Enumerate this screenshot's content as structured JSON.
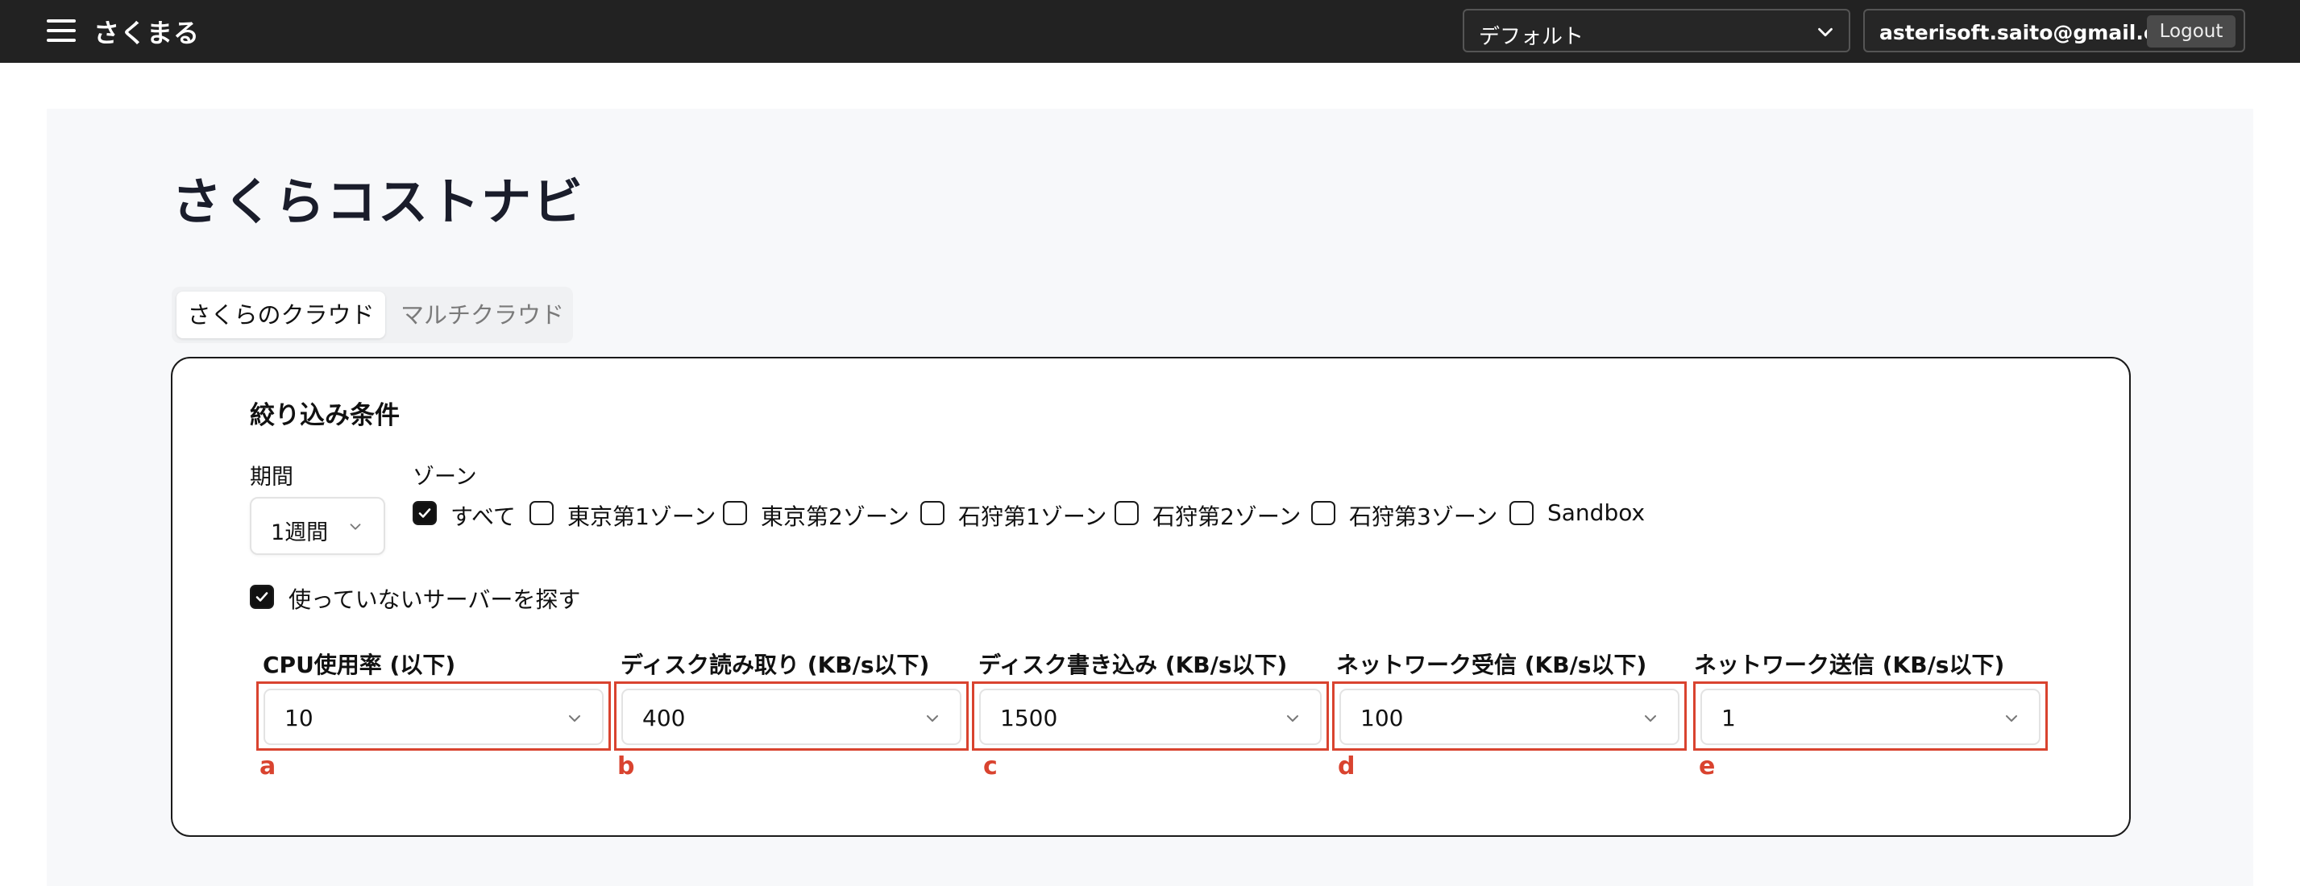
{
  "header": {
    "brand": "さくまる",
    "profile_select": {
      "value": "デフォルト"
    },
    "account": {
      "email": "asterisoft.saito@gmail.com",
      "logout_label": "Logout"
    }
  },
  "main": {
    "title": "さくらコストナビ",
    "tabs": [
      {
        "label": "さくらのクラウド",
        "active": true
      },
      {
        "label": "マルチクラウド",
        "active": false
      }
    ],
    "filters": {
      "title": "絞り込み条件",
      "period": {
        "label": "期間",
        "value": "1週間"
      },
      "zone": {
        "label": "ゾーン",
        "options": [
          {
            "label": "すべて",
            "checked": true
          },
          {
            "label": "東京第1ゾーン",
            "checked": false
          },
          {
            "label": "東京第2ゾーン",
            "checked": false
          },
          {
            "label": "石狩第1ゾーン",
            "checked": false
          },
          {
            "label": "石狩第2ゾーン",
            "checked": false
          },
          {
            "label": "石狩第3ゾーン",
            "checked": false
          },
          {
            "label": "Sandbox",
            "checked": false
          }
        ]
      },
      "unused_servers": {
        "label": "使っていないサーバーを探す",
        "checked": true
      },
      "thresholds": [
        {
          "label": "CPU使用率 (以下)",
          "value": "10",
          "marker": "a"
        },
        {
          "label": "ディスク読み取り (KB/s以下)",
          "value": "400",
          "marker": "b"
        },
        {
          "label": "ディスク書き込み (KB/s以下)",
          "value": "1500",
          "marker": "c"
        },
        {
          "label": "ネットワーク受信 (KB/s以下)",
          "value": "100",
          "marker": "d"
        },
        {
          "label": "ネットワーク送信 (KB/s以下)",
          "value": "1",
          "marker": "e"
        }
      ]
    }
  },
  "colors": {
    "topbar": "#222222",
    "highlight": "#d9432f",
    "page_bg": "#f7f8fa"
  },
  "icons": {
    "menu": "hamburger-icon",
    "dropdown": "chevron-down-icon",
    "check": "checkmark-icon"
  }
}
